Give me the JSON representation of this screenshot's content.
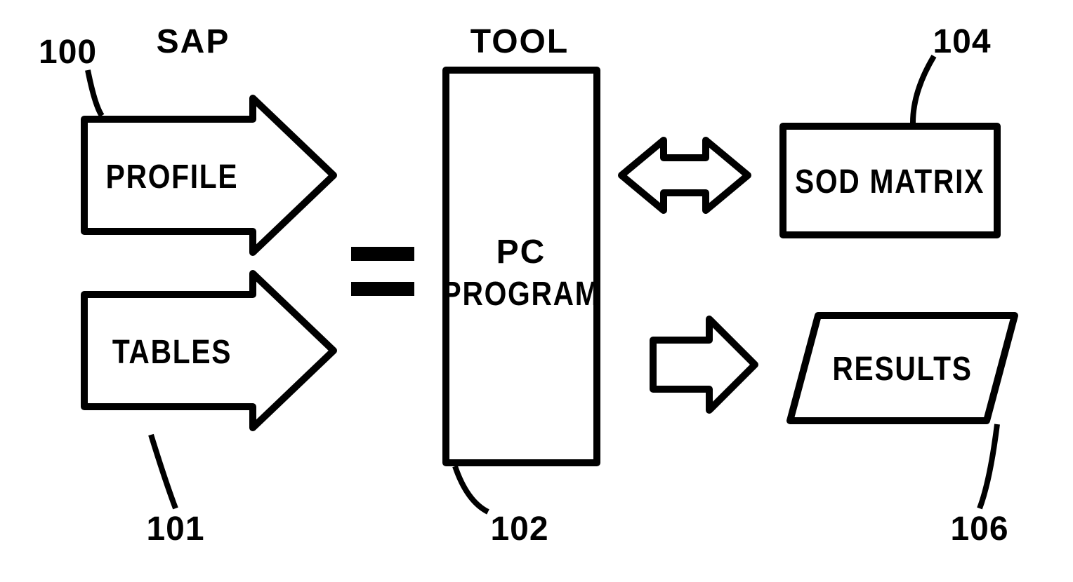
{
  "headers": {
    "sap": "SAP",
    "tool": "TOOL"
  },
  "blocks": {
    "profile": "PROFILE",
    "tables": "TABLES",
    "pc": "PC",
    "program": "PROGRAM",
    "sodMatrix": "SOD  MATRIX",
    "results": "RESULTS"
  },
  "refs": {
    "r100": "100",
    "r101": "101",
    "r102": "102",
    "r104": "104",
    "r106": "106"
  }
}
